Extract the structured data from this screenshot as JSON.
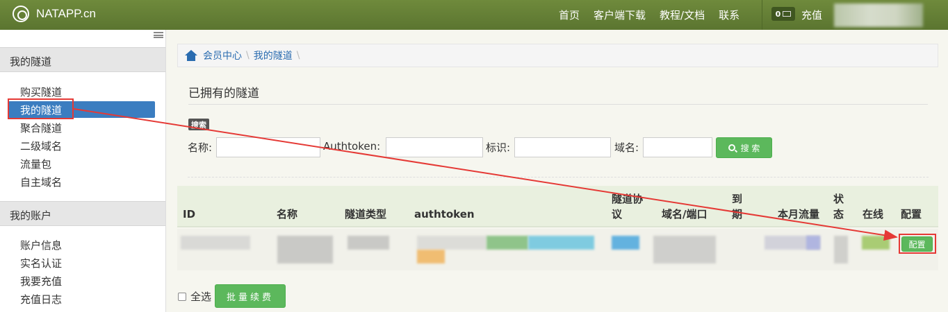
{
  "navbar": {
    "brand": "NATAPP.cn",
    "links": [
      "首页",
      "客户端下载",
      "教程/文档",
      "联系"
    ],
    "message_count": "0",
    "recharge": "充值"
  },
  "sidebar": {
    "sections": [
      {
        "title": "我的隧道",
        "items": [
          "购买隧道",
          "我的隧道",
          "聚合隧道",
          "二级域名",
          "流量包",
          "自主域名"
        ]
      },
      {
        "title": "我的账户",
        "items": [
          "账户信息",
          "实名认证",
          "我要充值",
          "充值日志"
        ]
      }
    ],
    "active_item": "我的隧道"
  },
  "breadcrumb": [
    "会员中心",
    "我的隧道"
  ],
  "page": {
    "title": "已拥有的隧道",
    "search_badge": "搜索",
    "filters": {
      "name_label": "名称:",
      "authtoken_label": "Authtoken:",
      "tag_label": "标识:",
      "domain_label": "域名:"
    },
    "search_button": "搜 索"
  },
  "table": {
    "headers": {
      "id": "ID",
      "name": "名称",
      "type": "隧道类型",
      "authtoken": "authtoken",
      "protocol_1": "隧道协",
      "protocol_2": "议",
      "domain_port": "域名/端口",
      "expire_1": "到",
      "expire_2": "期",
      "traffic": "本月流量",
      "status_1": "状",
      "status_2": "态",
      "online": "在线",
      "config": "配置"
    },
    "row_config_button": "配置"
  },
  "footer": {
    "select_all": "全选",
    "batch_renew": "批量续费"
  },
  "colors": {
    "navbar": "#5b7530",
    "accent": "#5cb85c",
    "active": "#3b7dc0",
    "annotation": "#e53935"
  }
}
